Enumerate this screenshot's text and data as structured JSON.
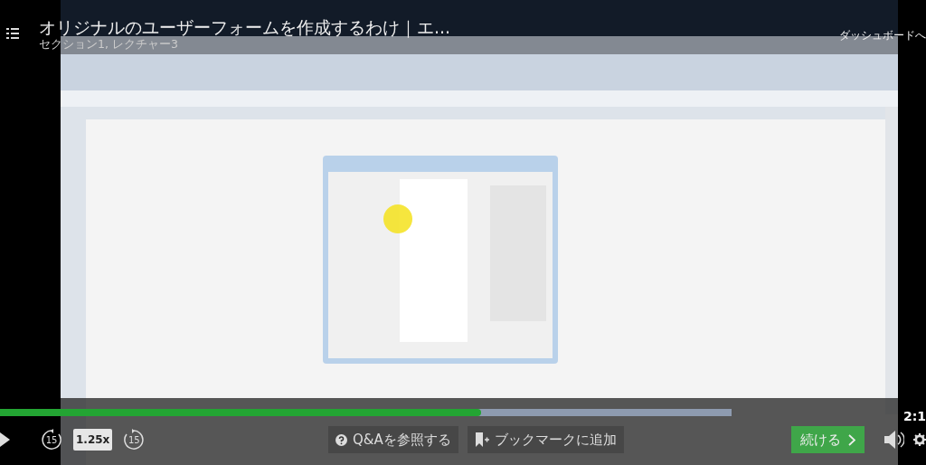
{
  "header": {
    "title": "オリジナルのユーザーフォームを作成するわけ｜エ...",
    "subtitle": "セクション1, レクチャー3",
    "dashboard_link": "ダッシュボードへ"
  },
  "progress": {
    "level": 0.52,
    "buffer": {
      "level": 0.79
    }
  },
  "time": "2:1",
  "controls": {
    "rewind": "15",
    "speed": "1.25x",
    "forward": "15"
  },
  "buttons": [
    {
      "kind": "qa",
      "label": "Q&Aを参照する"
    },
    {
      "kind": "bookmark",
      "label": "ブックマークに追加"
    },
    {
      "kind": "continue",
      "label": "続ける"
    }
  ]
}
